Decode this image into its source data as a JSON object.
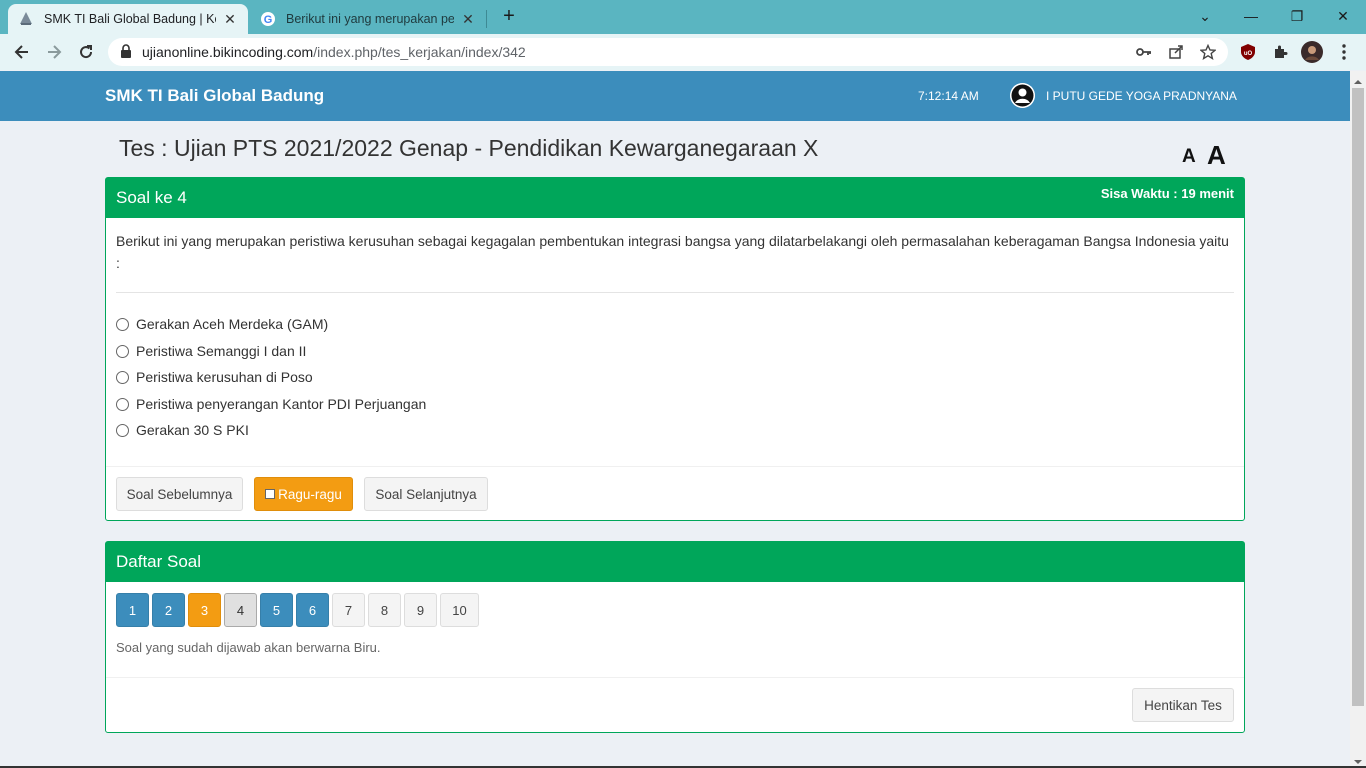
{
  "browser": {
    "tabs": [
      {
        "title": "SMK TI Bali Global Badung | Kerja",
        "active": true
      },
      {
        "title": "Berikut ini yang merupakan peris",
        "active": false
      }
    ],
    "url_host": "ujianonline.bikincoding.com",
    "url_path": "/index.php/tes_kerjakan/index/342"
  },
  "header": {
    "brand": "SMK TI Bali Global Badung",
    "clock": "7:12:14 AM",
    "user": "I PUTU GEDE YOGA PRADNYANA"
  },
  "page": {
    "title": "Tes : Ujian PTS 2021/2022 Genap - Pendidikan Kewarganegaraan X",
    "font_small": "A",
    "font_large": "A"
  },
  "question_box": {
    "title": "Soal ke 4",
    "timer": "Sisa Waktu : 19 menit",
    "question": "Berikut ini yang merupakan peristiwa kerusuhan sebagai kegagalan pembentukan integrasi bangsa yang dilatarbelakangi oleh permasalahan keberagaman Bangsa Indonesia yaitu :",
    "options": [
      "Gerakan Aceh Merdeka (GAM)",
      "Peristiwa Semanggi I dan II",
      "Peristiwa kerusuhan di Poso",
      "Peristiwa penyerangan Kantor PDI Perjuangan",
      "Gerakan 30 S PKI"
    ],
    "prev_label": "Soal Sebelumnya",
    "doubt_label": "Ragu-ragu",
    "next_label": "Soal Selanjutnya"
  },
  "list_box": {
    "title": "Daftar Soal",
    "numbers": [
      {
        "label": "1",
        "status": "answered"
      },
      {
        "label": "2",
        "status": "answered"
      },
      {
        "label": "3",
        "status": "doubt"
      },
      {
        "label": "4",
        "status": "current"
      },
      {
        "label": "5",
        "status": "answered"
      },
      {
        "label": "6",
        "status": "answered"
      },
      {
        "label": "7",
        "status": "unanswered"
      },
      {
        "label": "8",
        "status": "unanswered"
      },
      {
        "label": "9",
        "status": "unanswered"
      },
      {
        "label": "10",
        "status": "unanswered"
      }
    ],
    "note": "Soal yang sudah dijawab akan berwarna Biru.",
    "stop_label": "Hentikan Tes"
  },
  "colors": {
    "header": "#3c8dbc",
    "box": "#00a65a",
    "answered": "#3c8dbc",
    "doubt": "#f39c12"
  }
}
